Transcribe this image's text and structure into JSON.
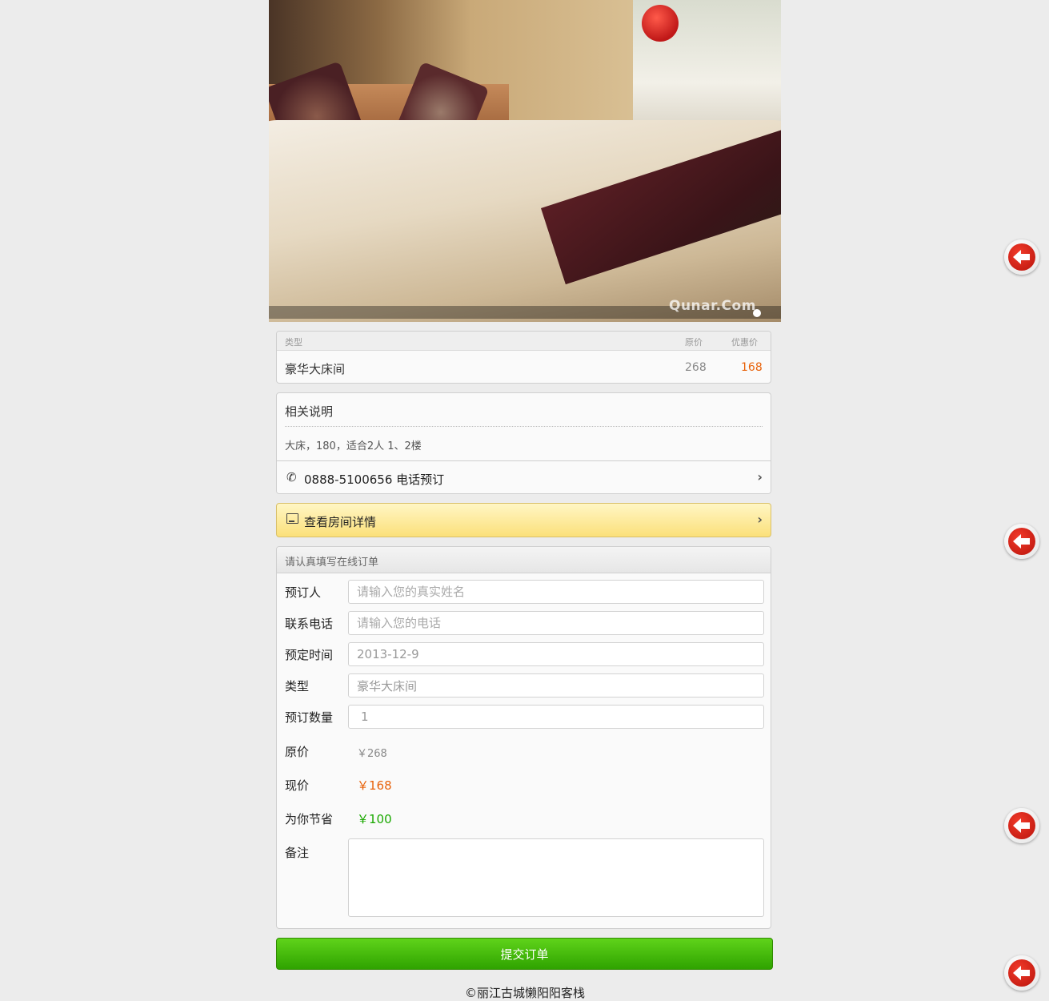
{
  "hero": {
    "watermark": "Qunar.Com"
  },
  "price_table": {
    "header": {
      "type_label": "类型",
      "orig_label": "原价",
      "discount_label": "优惠价"
    },
    "row": {
      "room": "豪华大床间",
      "orig": "268",
      "discount": "168"
    }
  },
  "description": {
    "title": "相关说明",
    "text": "大床，180，适合2人 1、2楼",
    "phone_text": "0888-5100656 电话预订"
  },
  "room_detail_link": "查看房间详情",
  "order_form": {
    "heading": "请认真填写在线订单",
    "name_label": "预订人",
    "name_placeholder": "请输入您的真实姓名",
    "phone_label": "联系电话",
    "phone_placeholder": "请输入您的电话",
    "date_label": "预定时间",
    "date_value": "2013-12-9",
    "type_label": "类型",
    "type_value": "豪华大床间",
    "qty_label": "预订数量",
    "qty_value": "1",
    "orig_price_label": "原价",
    "orig_price_value": "￥268",
    "now_price_label": "现价",
    "now_price_value": "￥168",
    "save_label": "为你节省",
    "save_value": "￥100",
    "note_label": "备注"
  },
  "submit_label": "提交订单",
  "footer_text": "©丽江古城懒阳阳客栈",
  "colors": {
    "discount": "#e8620a",
    "savings": "#1aa800",
    "submit": "#3cb30a",
    "back_button": "#d01c12"
  },
  "icons": {
    "phone": "phone-icon",
    "picture": "picture-icon",
    "chevron": "chevron-right-icon",
    "back": "back-arrow-icon"
  }
}
